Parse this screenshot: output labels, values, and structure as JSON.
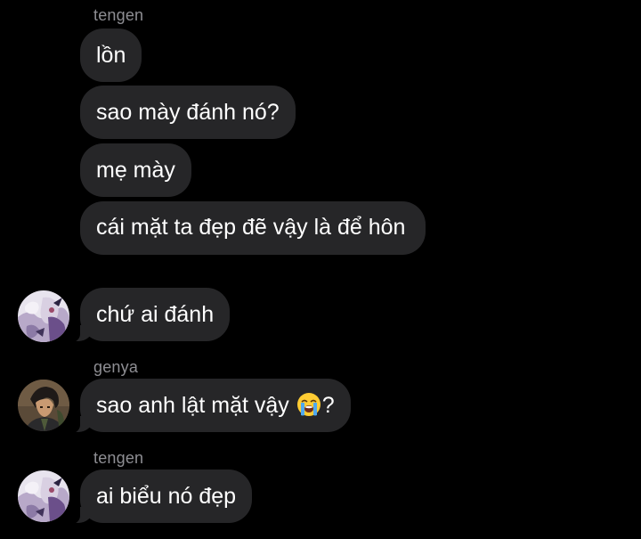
{
  "conversation": {
    "groups": [
      {
        "sender": "tengen",
        "messages": [
          "lồn",
          "sao mày đánh nó?",
          "mẹ mày",
          "cái mặt ta đẹp đẽ vậy là để hôn",
          "chứ ai đánh"
        ],
        "avatar_icon": "tengen-avatar"
      },
      {
        "sender": "genya",
        "messages": [
          "sao anh lật mặt vậy",
          "?"
        ],
        "emoji": "loudly-crying-face-emoji",
        "avatar_icon": "genya-avatar"
      },
      {
        "sender": "tengen",
        "messages": [
          "ai biểu nó đẹp"
        ],
        "avatar_icon": "tengen-avatar"
      }
    ]
  },
  "colors": {
    "background": "#000000",
    "bubble": "#262628",
    "sender_name": "#8e8e93",
    "text": "#ffffff"
  }
}
